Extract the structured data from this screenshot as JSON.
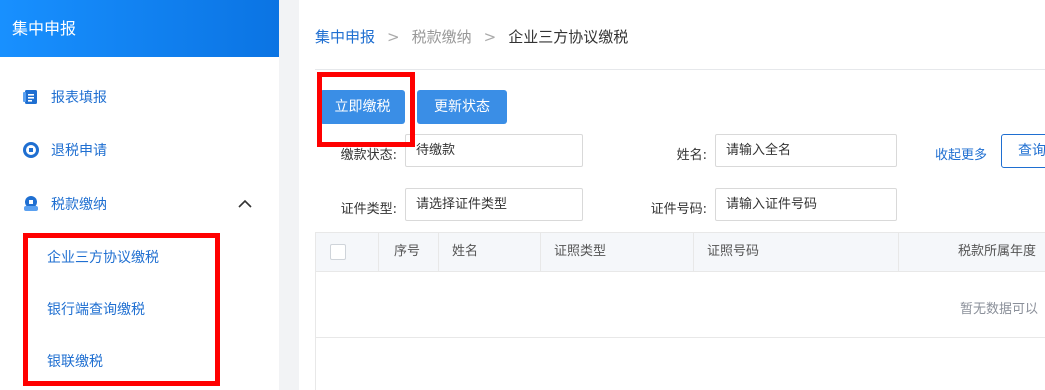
{
  "sidebar": {
    "title": "集中申报",
    "items": [
      {
        "label": "报表填报",
        "icon": "document-icon"
      },
      {
        "label": "退税申请",
        "icon": "tax-refund-icon"
      },
      {
        "label": "税款缴纳",
        "icon": "tax-payment-icon",
        "expanded": true
      }
    ],
    "sub_items": [
      "企业三方协议缴税",
      "银行端查询缴税",
      "银联缴税"
    ]
  },
  "breadcrumb": {
    "items": [
      "集中申报",
      "税款缴纳",
      "企业三方协议缴税"
    ]
  },
  "toolbar": {
    "pay_now": "立即缴税",
    "update_status": "更新状态"
  },
  "filters": {
    "status_label": "缴款状态:",
    "status_value": "待缴款",
    "name_label": "姓名:",
    "name_placeholder": "请输入全名",
    "id_type_label": "证件类型:",
    "id_type_placeholder": "请选择证件类型",
    "id_number_label": "证件号码:",
    "id_number_placeholder": "请输入证件号码",
    "collapse_more": "收起更多",
    "query": "查询"
  },
  "table": {
    "columns": [
      "序号",
      "姓名",
      "证照类型",
      "证照号码",
      "税款所属年度"
    ],
    "empty_text": "暂无数据可以"
  },
  "colors": {
    "accent": "#1f6fd1",
    "header_bg": "#1890ff",
    "button_bg": "#3a8ee6",
    "highlight": "#ff0000"
  }
}
